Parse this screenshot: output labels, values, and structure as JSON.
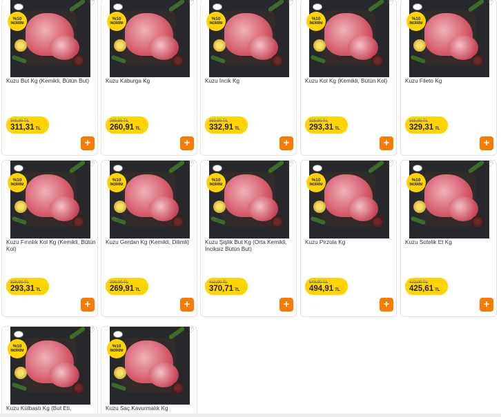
{
  "currency": "TL",
  "discount": {
    "line1": "%10",
    "line2": "İNDİRİM"
  },
  "add_label": "+",
  "products": [
    {
      "name": "Kuzu But Kg (Kemikli, Bütün But)",
      "old_price": "345,90 TL",
      "price": "311,31"
    },
    {
      "name": "Kuzu Kaburga Kg",
      "old_price": "289,90 TL",
      "price": "260,91"
    },
    {
      "name": "Kuzu İncik Kg",
      "old_price": "369,90 TL",
      "price": "332,91"
    },
    {
      "name": "Kuzu Kol Kg (Kemikli, Bütün Kol)",
      "old_price": "325,90 TL",
      "price": "293,31"
    },
    {
      "name": "Kuzu Fileto Kg",
      "old_price": "365,90 TL",
      "price": "329,31"
    },
    {
      "name": "Kuzu Fırınlık Kol Kg (Kemikli, Bütün Kol)",
      "old_price": "325,90 TL",
      "price": "293,31"
    },
    {
      "name": "Kuzu Gerdan Kg (Kemikli, Dilimli)",
      "old_price": "299,90 TL",
      "price": "269,91"
    },
    {
      "name": "Kuzu Şişlik But Kg (Orta Kemikli, İnciksiz Bütün But)",
      "old_price": "411,90 TL",
      "price": "370,71"
    },
    {
      "name": "Kuzu Pirzola Kg",
      "old_price": "549,90 TL",
      "price": "494,91"
    },
    {
      "name": "Kuzu Sotelik Et Kg",
      "old_price": "472,90 TL",
      "price": "425,61"
    },
    {
      "name": "Kuzu Külbastı Kg (But Eti,",
      "old_price": "",
      "price": ""
    },
    {
      "name": "Kuzu Saç Kavurmalık Kg",
      "old_price": "",
      "price": ""
    }
  ],
  "colors": {
    "badge": "#ffd400",
    "add_button": "#f57c00",
    "price_pill": "#ffd400"
  }
}
